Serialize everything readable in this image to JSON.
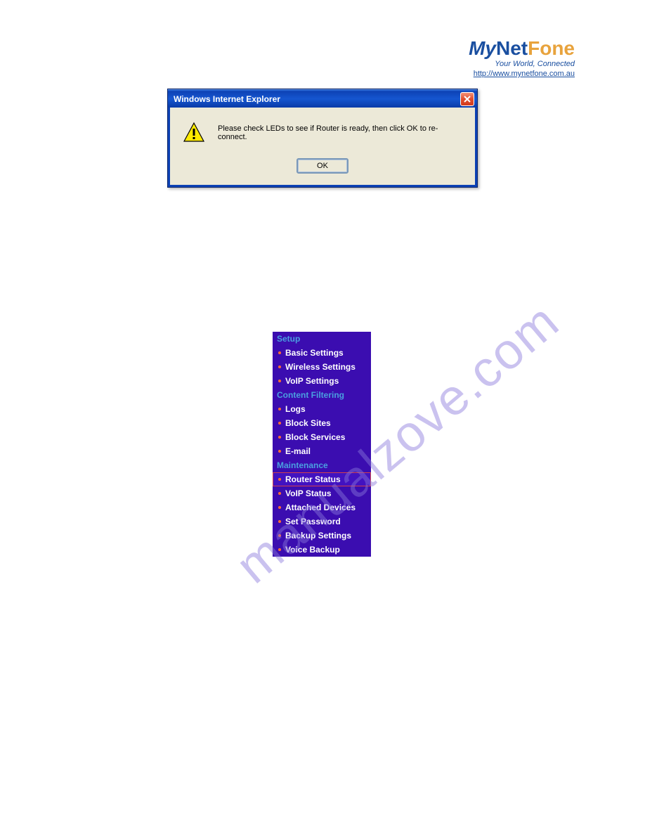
{
  "logo": {
    "part1": "My",
    "part2": "Net",
    "part3": "Fone",
    "tagline": "Your World, Connected",
    "url": "http://www.mynetfone.com.au"
  },
  "dialog": {
    "title": "Windows Internet Explorer",
    "message": "Please check LEDs to see if Router is ready, then click OK to re-connect.",
    "ok_label": "OK"
  },
  "nav": {
    "sections": [
      {
        "header": "Setup",
        "items": [
          {
            "label": "Basic Settings",
            "selected": false
          },
          {
            "label": "Wireless Settings",
            "selected": false
          },
          {
            "label": "VoIP Settings",
            "selected": false
          }
        ]
      },
      {
        "header": "Content Filtering",
        "items": [
          {
            "label": "Logs",
            "selected": false
          },
          {
            "label": "Block Sites",
            "selected": false
          },
          {
            "label": "Block Services",
            "selected": false
          },
          {
            "label": "E-mail",
            "selected": false
          }
        ]
      },
      {
        "header": "Maintenance",
        "items": [
          {
            "label": "Router Status",
            "selected": true
          },
          {
            "label": "VoIP Status",
            "selected": false
          },
          {
            "label": "Attached Devices",
            "selected": false
          },
          {
            "label": "Set Password",
            "selected": false
          },
          {
            "label": "Backup Settings",
            "selected": false
          },
          {
            "label": "Voice Backup",
            "selected": false
          }
        ]
      }
    ]
  },
  "watermark": "manualzove.com"
}
